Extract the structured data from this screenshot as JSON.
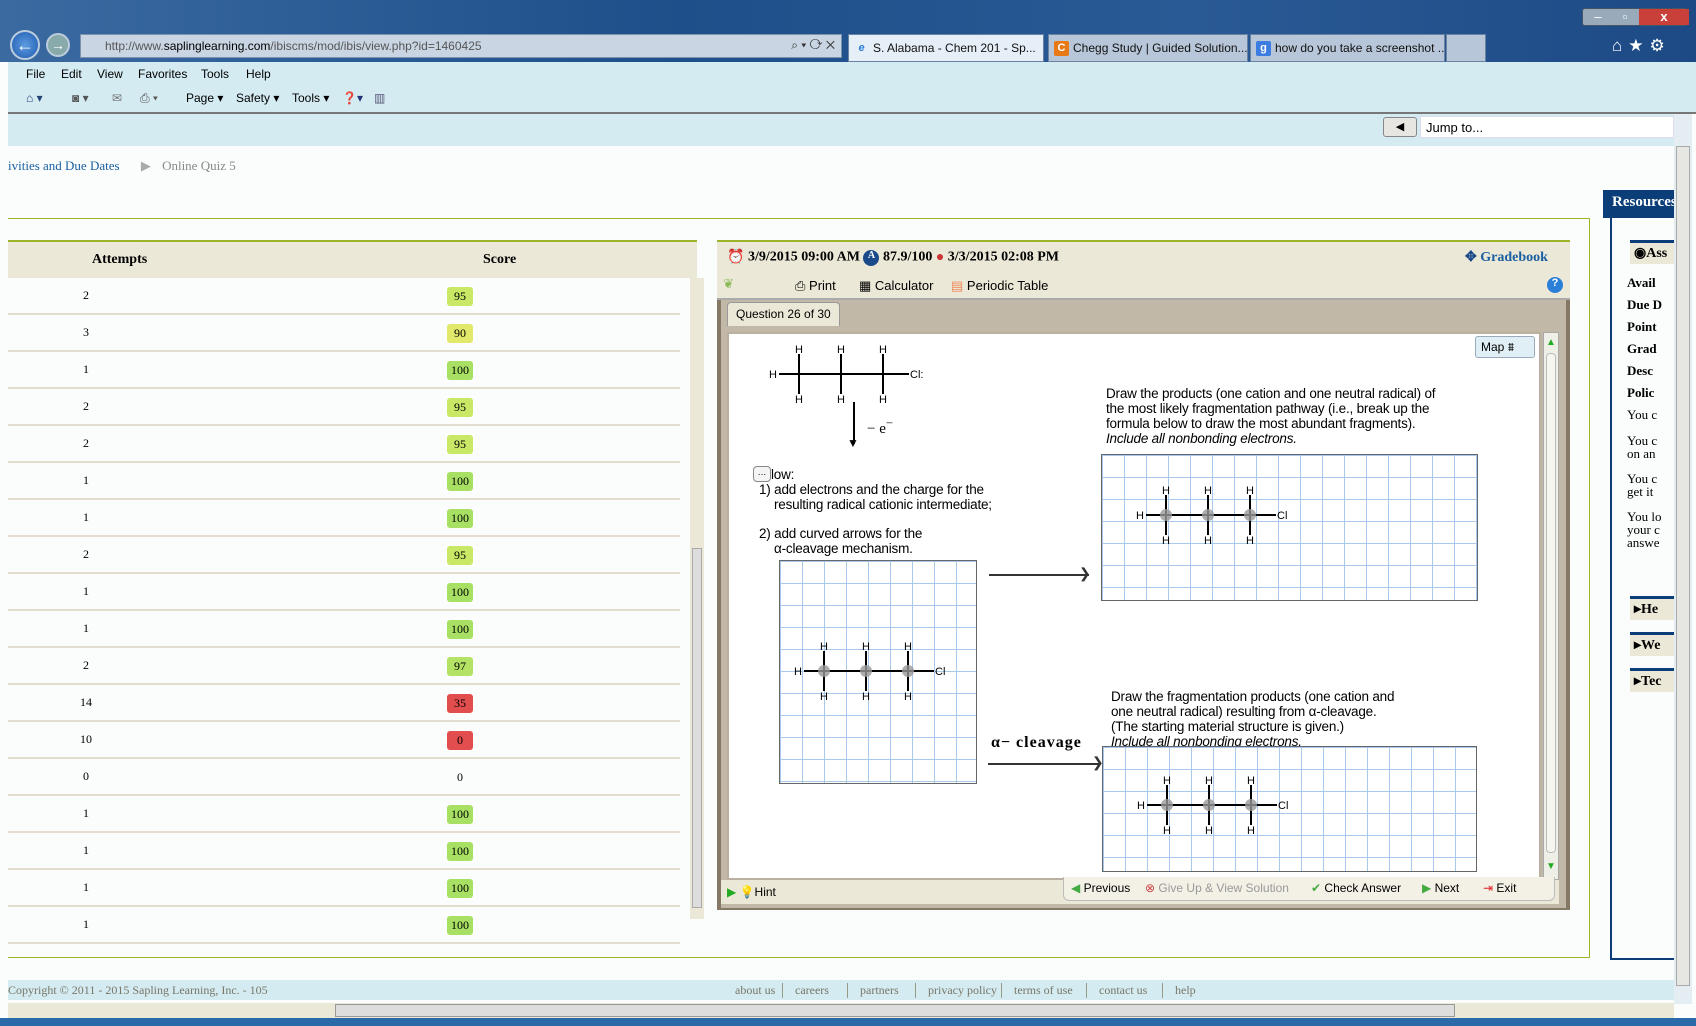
{
  "browser": {
    "url_prefix": "http://www.",
    "url_domain": "saplinglearning.com",
    "url_path": "/ibiscms/mod/ibis/view.php?id=1460425",
    "tabs": [
      {
        "label": "S. Alabama - Chem 201 - Sp...",
        "icon": "ie-icon"
      },
      {
        "label": "Chegg Study | Guided Solution...",
        "icon": "chegg-icon"
      },
      {
        "label": "how do you take a screenshot ...",
        "icon": "google-icon"
      }
    ],
    "menu": [
      "File",
      "Edit",
      "View",
      "Favorites",
      "Tools",
      "Help"
    ],
    "toolbar": [
      "Page",
      "Safety",
      "Tools"
    ],
    "jump_placeholder": "Jump to..."
  },
  "breadcrumb": {
    "items": [
      "ivities and Due Dates",
      "Online Quiz 5"
    ]
  },
  "table": {
    "headers": [
      "Attempts",
      "Score"
    ],
    "rows": [
      {
        "attempts": "2",
        "score": "95",
        "color": "#c8e866"
      },
      {
        "attempts": "3",
        "score": "90",
        "color": "#e2e86a"
      },
      {
        "attempts": "1",
        "score": "100",
        "color": "#a8e064"
      },
      {
        "attempts": "2",
        "score": "95",
        "color": "#c8e866"
      },
      {
        "attempts": "2",
        "score": "95",
        "color": "#c8e866"
      },
      {
        "attempts": "1",
        "score": "100",
        "color": "#a8e064"
      },
      {
        "attempts": "1",
        "score": "100",
        "color": "#a8e064"
      },
      {
        "attempts": "2",
        "score": "95",
        "color": "#c8e866"
      },
      {
        "attempts": "1",
        "score": "100",
        "color": "#a8e064"
      },
      {
        "attempts": "1",
        "score": "100",
        "color": "#a8e064"
      },
      {
        "attempts": "2",
        "score": "97",
        "color": "#b4e264"
      },
      {
        "attempts": "14",
        "score": "35",
        "color": "#e24e4e"
      },
      {
        "attempts": "10",
        "score": "0",
        "color": "#e24e4e"
      },
      {
        "attempts": "0",
        "score": "0",
        "color": "#fbfdfd"
      },
      {
        "attempts": "1",
        "score": "100",
        "color": "#a8e064"
      },
      {
        "attempts": "1",
        "score": "100",
        "color": "#a8e064"
      },
      {
        "attempts": "1",
        "score": "100",
        "color": "#a8e064"
      },
      {
        "attempts": "1",
        "score": "100",
        "color": "#a8e064"
      }
    ]
  },
  "quiz": {
    "due": "3/9/2015 09:00 AM",
    "grade": "87.9/100",
    "last": "3/3/2015 02:08 PM",
    "gradebook": "Gradebook",
    "tools": [
      "Print",
      "Calculator",
      "Periodic Table"
    ],
    "question_tab": "Question 26 of 30",
    "map": "Map",
    "minus_e": "− e",
    "superscript": "−",
    "instr_head": "low:",
    "instr1a": "1) add electrons and the charge for the",
    "instr1b": "resulting radical cationic intermediate;",
    "instr2a": "2) add curved arrows for the",
    "instr2b": "α-cleavage mechanism.",
    "top_text": [
      "Draw the products (one cation and one neutral radical) of",
      "the most likely fragmentation pathway (i.e., break up the",
      "formula below to draw the most abundant fragments)."
    ],
    "top_italic": "Include all nonbonding electrons.",
    "bottom_text": [
      "Draw the fragmentation products (one cation and",
      "one neutral radical) resulting from α-cleavage.",
      "(The starting material structure is given.)"
    ],
    "bottom_italic": "Include all nonbonding electrons.",
    "alpha_label": "α− cleavage",
    "atoms": {
      "h": "H",
      "cl": "Cl",
      "cl_lone": "Cl:"
    },
    "hint": "Hint",
    "nav": [
      "Previous",
      "Give Up & View Solution",
      "Check Answer",
      "Next",
      "Exit"
    ]
  },
  "resources": {
    "title": "Resources",
    "section": "Ass",
    "labels": [
      "Avail",
      "Due D",
      "Point",
      "Grad",
      "Desc",
      "Polic"
    ],
    "texts": [
      [
        "You c"
      ],
      [
        "You c",
        "on an"
      ],
      [
        "You c",
        "get it"
      ],
      [
        "You lo",
        "your c",
        "answe"
      ]
    ],
    "sections": [
      "He",
      "We",
      "Tec"
    ]
  },
  "footer": {
    "copyright": "Copyright © 2011 - 2015 Sapling Learning, Inc. - 105",
    "links": [
      "about us",
      "careers",
      "partners",
      "privacy policy",
      "terms of use",
      "contact us",
      "help"
    ]
  }
}
